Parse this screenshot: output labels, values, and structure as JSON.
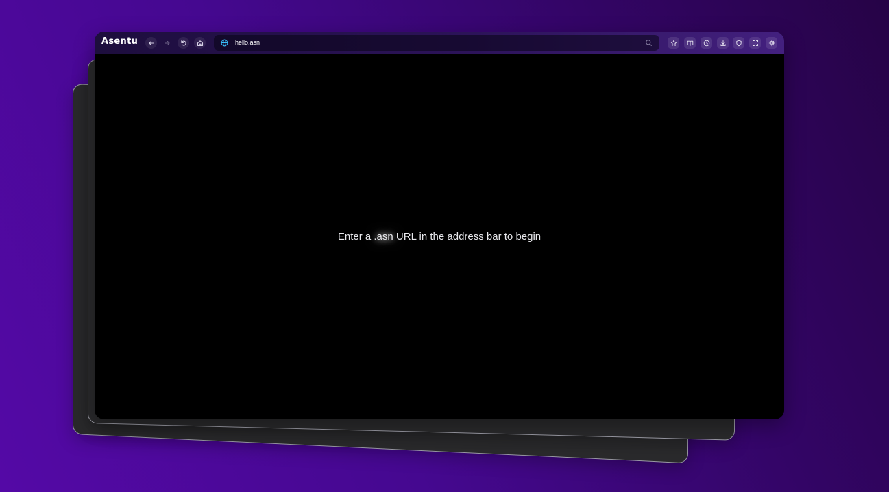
{
  "browser": {
    "brand": "Asentu",
    "address_bar": {
      "url": "hello.asn",
      "leading_icon": "globe-icon",
      "trailing_icon": "search-icon"
    },
    "nav_buttons": [
      {
        "name": "back",
        "icon": "arrow-left-icon",
        "enabled": true
      },
      {
        "name": "forward",
        "icon": "arrow-right-icon",
        "enabled": false
      },
      {
        "name": "reload",
        "icon": "reload-icon",
        "enabled": true
      },
      {
        "name": "home",
        "icon": "home-icon",
        "enabled": true
      }
    ],
    "toolbar_buttons": [
      {
        "name": "bookmark",
        "icon": "star-icon"
      },
      {
        "name": "reading-list",
        "icon": "book-icon"
      },
      {
        "name": "history",
        "icon": "clock-icon"
      },
      {
        "name": "downloads",
        "icon": "download-icon"
      },
      {
        "name": "shield",
        "icon": "shield-icon"
      },
      {
        "name": "fullscreen",
        "icon": "fullscreen-icon"
      },
      {
        "name": "settings",
        "icon": "gear-icon"
      }
    ]
  },
  "page": {
    "message_before": "Enter a ",
    "message_highlight": ".asn",
    "message_after": " URL in the address bar to begin"
  },
  "colors": {
    "background_start": "#5409a6",
    "background_end": "#260346",
    "toolbar_start": "#1d0e3d",
    "toolbar_end": "#43207f",
    "viewport": "#000000",
    "stack_card": "#2a2a2c",
    "globe_accent": "#38bdf8"
  }
}
